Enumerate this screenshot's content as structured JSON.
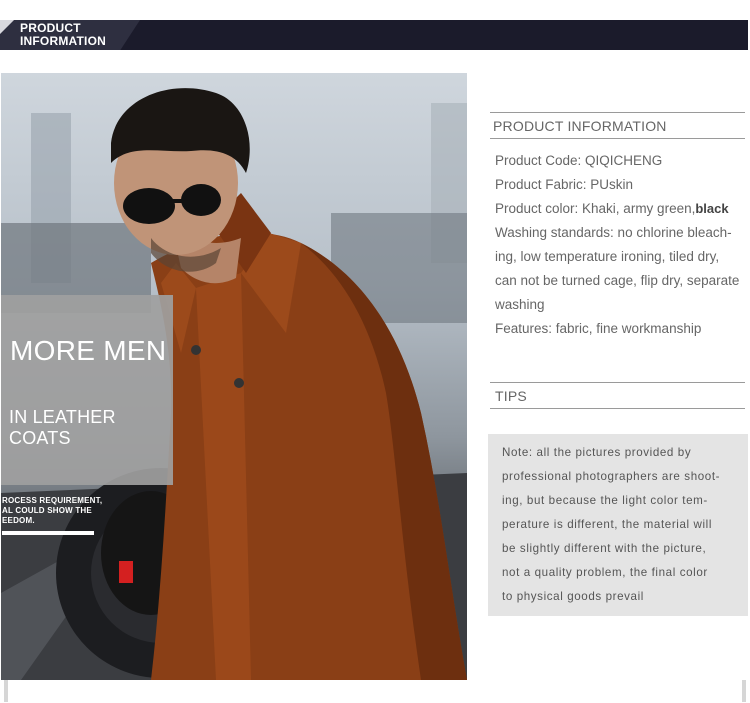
{
  "banner": {
    "title": "PRODUCT\nINFORMATION"
  },
  "photo": {
    "overlay_line1": "MORE MEN",
    "overlay_line2": "IN LEATHER COATS",
    "promo_text": "ROCESS REQUIREMENT,\nAL COULD SHOW THE\nEEDOM."
  },
  "product_info": {
    "heading": "PRODUCT INFORMATION",
    "product_code": "Product Code: QIQICHENG",
    "product_fabric": "Product Fabric: PUskin",
    "product_color_prefix": "Product color: Khaki, army green,",
    "product_color_strong": "black",
    "washing_1": "Washing standards: no chlorine bleach-",
    "washing_2": "ing, low temperature ironing, tiled dry,",
    "washing_3": "can not be turned cage, flip dry, separate",
    "washing_4": "washing",
    "features": "Features: fabric, fine workmanship"
  },
  "tips": {
    "heading": "TIPS",
    "line1": "Note: all the pictures provided by",
    "line2": "professional photographers are shoot-",
    "line3": "ing, but because the light color tem-",
    "line4": "perature is different, the material will",
    "line5": "be slightly different with the picture,",
    "line6": "not a quality problem, the final color",
    "line7": "to physical goods prevail"
  },
  "colors": {
    "banner_bg": "#1b1b2b",
    "overlay_bg": "#a0a0a0",
    "tips_bg": "#e4e4e4",
    "jacket": "#8a3f16"
  }
}
